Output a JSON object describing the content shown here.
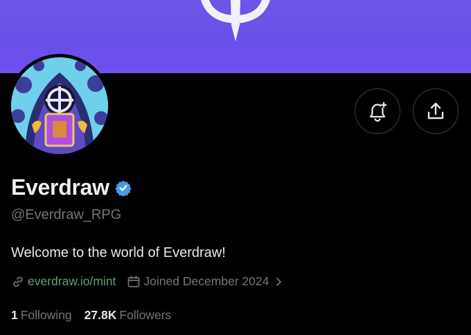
{
  "profile": {
    "display_name": "Everdraw",
    "handle": "@Everdraw_RPG",
    "bio": "Welcome to the world of Everdraw!",
    "website": "everdraw.io/mint",
    "joined": "Joined December 2024",
    "following_count": "1",
    "following_label": "Following",
    "followers_count": "27.8K",
    "followers_label": "Followers"
  },
  "icons": {
    "verified": "verified-badge-icon",
    "notify": "bell-plus-icon",
    "share": "share-icon",
    "link": "link-icon",
    "calendar": "calendar-icon",
    "chevron": "chevron-right-icon"
  },
  "colors": {
    "banner": "#6a4fe9",
    "verified": "#4a99e9",
    "link": "#5fa06e",
    "muted": "#71767b"
  }
}
